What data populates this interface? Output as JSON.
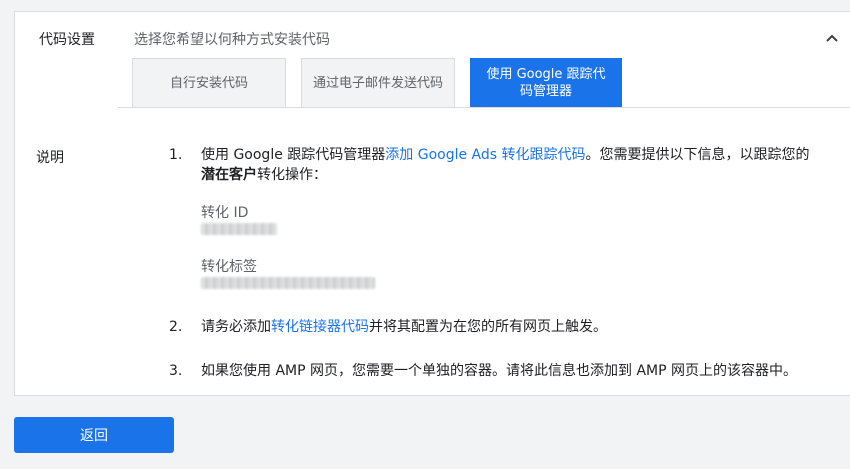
{
  "section": {
    "title": "代码设置",
    "subtitle": "选择您希望以何种方式安装代码"
  },
  "icons": {
    "collapse": "chevron-up-icon"
  },
  "tabs": [
    {
      "label": "自行安装代码",
      "active": false
    },
    {
      "label": "通过电子邮件发送代码",
      "active": false
    },
    {
      "label": "使用 Google 跟踪代码管理器",
      "active": true
    }
  ],
  "description": {
    "label": "说明",
    "steps": [
      {
        "number": "1.",
        "text_prefix": "使用 Google 跟踪代码管理器",
        "link": "添加 Google Ads 转化跟踪代码",
        "text_suffix": "。您需要提供以下信息，以跟踪您的",
        "bold": "潜在客户",
        "text_end": "转化操作："
      },
      {
        "number": "2.",
        "text_prefix": "请务必添加",
        "link": "转化链接器代码",
        "text_suffix": "并将其配置为在您的所有网页上触发。"
      },
      {
        "number": "3.",
        "text": "如果您使用 AMP 网页，您需要一个单独的容器。请将此信息也添加到 AMP 网页上的该容器中。"
      }
    ],
    "fields": [
      {
        "label": "转化 ID"
      },
      {
        "label": "转化标签"
      }
    ]
  },
  "footer": {
    "back_label": "返回"
  },
  "colors": {
    "accent": "#1a73e8",
    "border": "#dadce0",
    "page_bg": "#f1f3f4"
  }
}
